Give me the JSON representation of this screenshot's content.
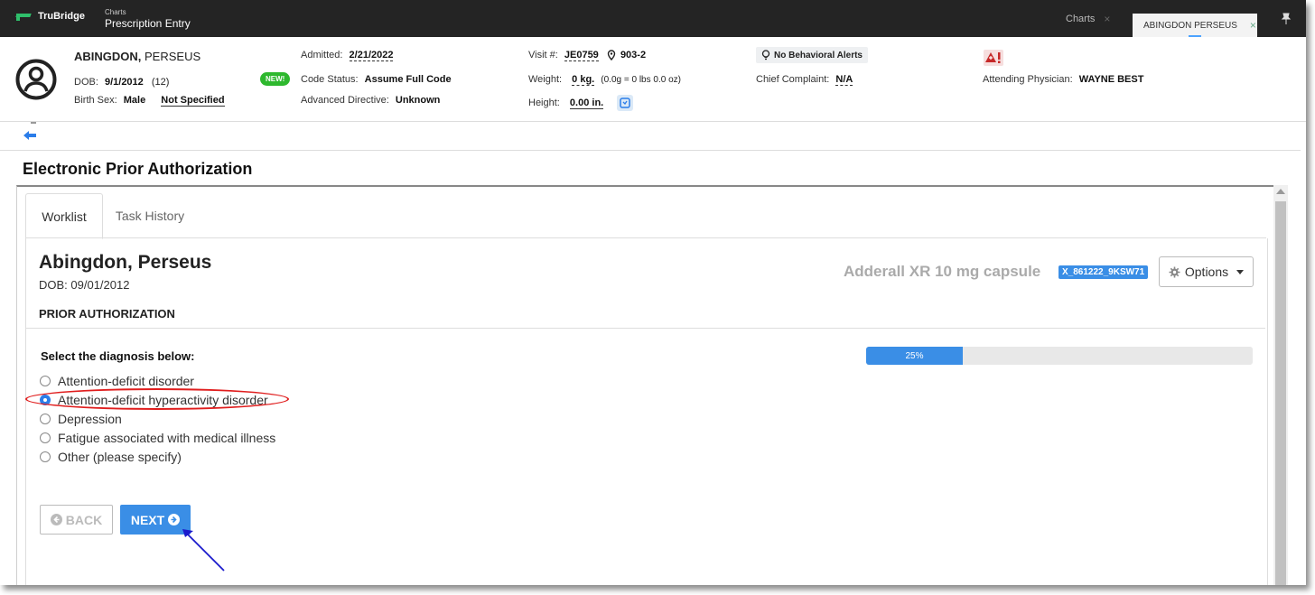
{
  "topbar": {
    "logo": "TruBridge",
    "crumb_parent": "Charts",
    "crumb_title": "Prescription Entry",
    "tabs": [
      {
        "label": "Charts",
        "close": "×"
      },
      {
        "label": "ABINGDON PERSEUS",
        "close": "×"
      }
    ],
    "pin_icon": "pin-icon"
  },
  "patient": {
    "last_name": "ABINGDON,",
    "first_name": " PERSEUS",
    "dob_label": "DOB:",
    "dob": "9/1/2012",
    "age": "(12)",
    "sex_label": "Birth Sex:",
    "sex": "Male",
    "gender": "Not Specified",
    "new_badge": "NEW!",
    "admitted_label": "Admitted:",
    "admitted": "2/21/2022",
    "code_status_label": "Code Status:",
    "code_status": "Assume Full Code",
    "adv_label": "Advanced Directive:",
    "adv": "Unknown",
    "visit_label": "Visit #:",
    "visit": "JE0759",
    "room": "903-2",
    "weight_label": "Weight:",
    "weight": "0 kg.",
    "weight_detail": "(0.0g = 0 lbs 0.0 oz)",
    "height_label": "Height:",
    "height": "0.00 in.",
    "behavioral": "No Behavioral Alerts",
    "complaint_label": "Chief Complaint:",
    "complaint": "N/A",
    "physician_label": "Attending Physician:",
    "physician": "WAYNE BEST"
  },
  "page": {
    "title": "Electronic Prior Authorization"
  },
  "tabs": {
    "worklist": "Worklist",
    "history": "Task History"
  },
  "worklist": {
    "patient_name": "Abingdon, Perseus",
    "patient_dob": "DOB: 09/01/2012",
    "drug": "Adderall XR 10 mg capsule",
    "drug_code": "X_861222_9KSW71",
    "options_label": "Options",
    "section": "PRIOR AUTHORIZATION",
    "question": "Select the diagnosis below:",
    "progress_label": "25%",
    "progress_value": 25,
    "options": [
      {
        "label": "Attention-deficit disorder",
        "selected": false
      },
      {
        "label": "Attention-deficit hyperactivity disorder",
        "selected": true
      },
      {
        "label": "Depression",
        "selected": false
      },
      {
        "label": "Fatigue associated with medical illness",
        "selected": false
      },
      {
        "label": "Other (please specify)",
        "selected": false
      }
    ],
    "back_label": "BACK",
    "next_label": "NEXT"
  },
  "colors": {
    "accent": "#3a8ee6",
    "highlight": "#e01e1e",
    "annotation": "#1a1acc",
    "new_badge": "#2eb82e"
  }
}
